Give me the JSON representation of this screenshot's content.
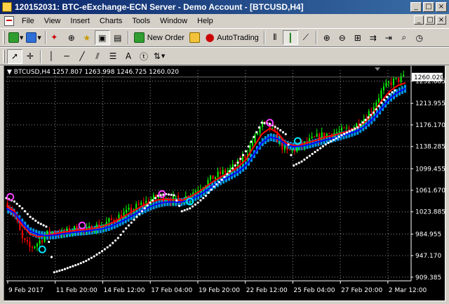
{
  "window": {
    "title": "120152031: BTC-eExchange-ECN Server - Demo Account - [BTCUSD,H4]",
    "controls": [
      "_",
      "□",
      "×"
    ]
  },
  "menu": {
    "items": [
      "File",
      "View",
      "Insert",
      "Charts",
      "Tools",
      "Window",
      "Help"
    ],
    "mdi_controls": [
      "_",
      "□",
      "×"
    ]
  },
  "toolbar": {
    "new_order_label": "New Order",
    "autotrading_label": "AutoTrading",
    "text_tool_label": "A"
  },
  "chart": {
    "header": "BTCUSD,H4  1257.807 1263.998 1246.725 1260.020",
    "current_price": "1260.020",
    "colors": {
      "background": "#000000",
      "grid": "#ffffff",
      "bull_candle": "#00ff00",
      "bear_candle": "#ff0000",
      "red_ma": "#ff0000",
      "blue_ma": "#0000ff",
      "channel_band": "#00aaff",
      "parabolic_sar": "#ffffff",
      "arrow_up": "#00e5ff",
      "arrow_down": "#ff40ff",
      "price_label_bg": "#ffffff"
    }
  },
  "chart_data": {
    "type": "line",
    "symbol": "BTCUSD",
    "timeframe": "H4",
    "ohlc_header": {
      "open": 1257.807,
      "high": 1263.998,
      "low": 1246.725,
      "close": 1260.02
    },
    "y_ticks": [
      "1252.885",
      "1213.955",
      "1176.170",
      "1138.285",
      "1099.455",
      "1061.670",
      "1023.885",
      "984.955",
      "947.170",
      "909.385"
    ],
    "x_ticks": [
      "9 Feb 2017",
      "11 Feb 20:00",
      "14 Feb 12:00",
      "17 Feb 04:00",
      "19 Feb 20:00",
      "22 Feb 12:00",
      "25 Feb 04:00",
      "27 Feb 20:00",
      "2 Mar 12:00"
    ],
    "ylim": [
      903,
      1272
    ],
    "x_range": [
      0,
      100
    ],
    "price": {
      "x": [
        0,
        2,
        4,
        6,
        8,
        10,
        12,
        14,
        16,
        18,
        20,
        22,
        24,
        26,
        28,
        30,
        32,
        34,
        36,
        38,
        40,
        42,
        44,
        46,
        48,
        50,
        52,
        54,
        56,
        58,
        60,
        62,
        64,
        66,
        68,
        70,
        72,
        74,
        76,
        78,
        80,
        82,
        84,
        86,
        88,
        90,
        92,
        94,
        96,
        98,
        100
      ],
      "y": [
        1040,
        1020,
        975,
        960,
        970,
        985,
        990,
        985,
        992,
        995,
        990,
        998,
        1000,
        1008,
        1015,
        1022,
        1030,
        1038,
        1045,
        1050,
        1048,
        1046,
        1045,
        1055,
        1065,
        1075,
        1085,
        1092,
        1098,
        1108,
        1125,
        1150,
        1178,
        1172,
        1150,
        1128,
        1132,
        1140,
        1148,
        1155,
        1160,
        1162,
        1165,
        1170,
        1178,
        1190,
        1210,
        1235,
        1250,
        1255,
        1260
      ]
    },
    "series": [
      {
        "name": "",
        "color": "#ff0000",
        "x": [
          0,
          2,
          4,
          6,
          8,
          10,
          12,
          14,
          16,
          18,
          20,
          22,
          24,
          26,
          28,
          30,
          32,
          34,
          36,
          38,
          40,
          42,
          44,
          46,
          48,
          50,
          52,
          54,
          56,
          58,
          60,
          62,
          64,
          66,
          68,
          70,
          72,
          74,
          76,
          78,
          80,
          82,
          84,
          86,
          88,
          90,
          92,
          94,
          96,
          98,
          100
        ],
        "y": [
          1035,
          1025,
          1000,
          985,
          980,
          983,
          985,
          988,
          990,
          992,
          993,
          995,
          998,
          1003,
          1010,
          1018,
          1026,
          1034,
          1040,
          1045,
          1046,
          1045,
          1044,
          1050,
          1058,
          1068,
          1078,
          1086,
          1093,
          1102,
          1115,
          1138,
          1160,
          1170,
          1162,
          1145,
          1140,
          1142,
          1146,
          1150,
          1155,
          1158,
          1162,
          1166,
          1172,
          1182,
          1198,
          1218,
          1235,
          1245,
          1250
        ]
      },
      {
        "name": "",
        "color": "#0000ff",
        "x": [
          0,
          2,
          4,
          6,
          8,
          10,
          12,
          14,
          16,
          18,
          20,
          22,
          24,
          26,
          28,
          30,
          32,
          34,
          36,
          38,
          40,
          42,
          44,
          46,
          48,
          50,
          52,
          54,
          56,
          58,
          60,
          62,
          64,
          66,
          68,
          70,
          72,
          74,
          76,
          78,
          80,
          82,
          84,
          86,
          88,
          90,
          92,
          94,
          96,
          98,
          100
        ],
        "y": [
          1030,
          1022,
          1005,
          990,
          984,
          982,
          983,
          985,
          987,
          989,
          990,
          992,
          994,
          998,
          1004,
          1011,
          1019,
          1026,
          1033,
          1038,
          1041,
          1041,
          1041,
          1045,
          1052,
          1061,
          1070,
          1079,
          1086,
          1094,
          1105,
          1124,
          1145,
          1155,
          1152,
          1142,
          1138,
          1139,
          1142,
          1146,
          1150,
          1153,
          1157,
          1161,
          1166,
          1175,
          1188,
          1205,
          1222,
          1233,
          1240
        ]
      }
    ],
    "parabolic_sar": {
      "x": [
        0,
        2,
        4,
        6,
        8,
        10,
        12,
        14,
        16,
        18,
        20,
        22,
        24,
        26,
        28,
        30,
        32,
        34,
        36,
        38,
        40,
        42,
        44,
        46,
        48,
        50,
        52,
        54,
        56,
        58,
        60,
        62,
        64,
        66,
        68,
        70,
        72,
        74,
        76,
        78,
        80,
        82,
        84,
        86,
        88,
        90,
        92,
        94,
        96,
        98
      ],
      "y": [
        1048,
        1042,
        1030,
        1015,
        1005,
        998,
        918,
        922,
        927,
        932,
        938,
        946,
        955,
        965,
        978,
        995,
        1010,
        1025,
        1040,
        1052,
        1055,
        1053,
        1025,
        1030,
        1040,
        1052,
        1068,
        1080,
        1095,
        1110,
        1130,
        1155,
        1180,
        1178,
        1170,
        1160,
        1105,
        1112,
        1122,
        1132,
        1142,
        1150,
        1158,
        1165,
        1172,
        1185,
        1198,
        1215,
        1230,
        1240
      ]
    },
    "signals": [
      {
        "x": 1,
        "y": 1050,
        "dir": "down"
      },
      {
        "x": 9,
        "y": 958,
        "dir": "up"
      },
      {
        "x": 19,
        "y": 1000,
        "dir": "down"
      },
      {
        "x": 39,
        "y": 1055,
        "dir": "down"
      },
      {
        "x": 46,
        "y": 1042,
        "dir": "up"
      },
      {
        "x": 66,
        "y": 1180,
        "dir": "down"
      },
      {
        "x": 73,
        "y": 1148,
        "dir": "up"
      }
    ]
  }
}
